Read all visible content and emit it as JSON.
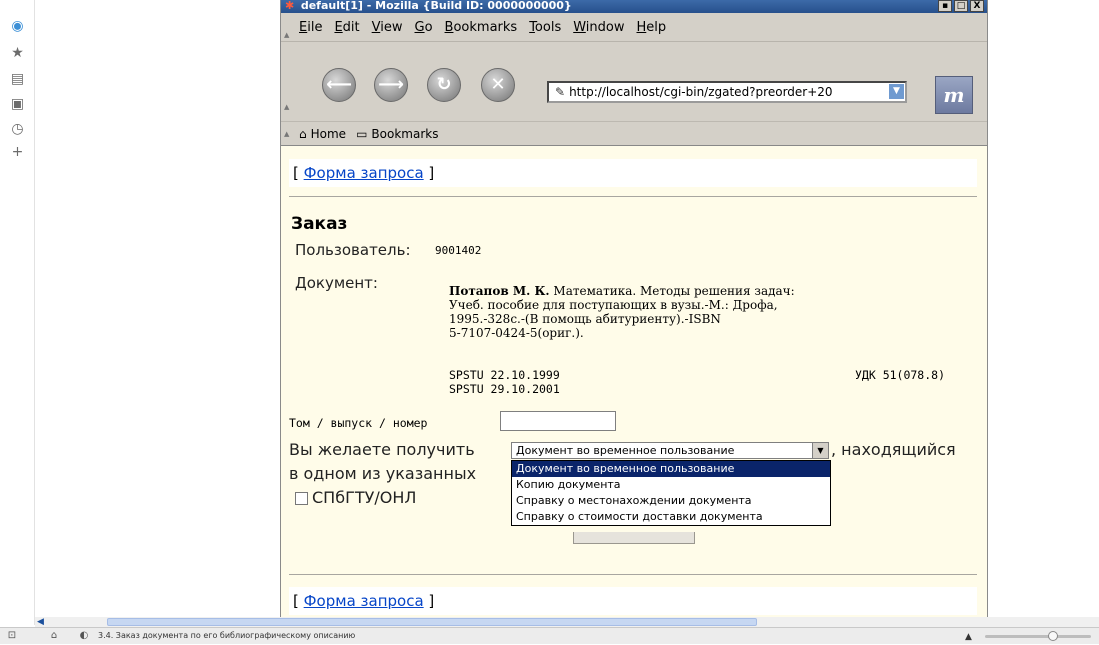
{
  "window": {
    "title": "default[1] - Mozilla {Build ID: 0000000000}",
    "buttons": [
      "▪",
      "□",
      "X"
    ]
  },
  "menu": {
    "items": [
      {
        "key": "E",
        "rest": "ile"
      },
      {
        "key": "E",
        "rest": "dit"
      },
      {
        "key": "V",
        "rest": "iew"
      },
      {
        "key": "G",
        "rest": "o"
      },
      {
        "key": "B",
        "rest": "ookmarks"
      },
      {
        "key": "T",
        "rest": "ools"
      },
      {
        "key": "W",
        "rest": "indow"
      },
      {
        "key": "H",
        "rest": "elp"
      }
    ]
  },
  "nav": {
    "url": "http://localhost/cgi-bin/zgated?preorder+20",
    "throbber": "m"
  },
  "personal_bar": {
    "home": "Home",
    "bookmarks": "Bookmarks"
  },
  "page": {
    "request_form_link": "Форма запроса",
    "bracket_open": "[",
    "bracket_close": "]",
    "title": "Заказ",
    "user_label": "Пользователь:",
    "user_value": "9001402",
    "doc_label": "Документ:",
    "doc_author": "Потапов М. К.",
    "doc_text_line1": " Математика. Методы решения задач:",
    "doc_text_lines": "Учеб. пособие для поступающих в вузы.-М.: Дрофа,\n1995.-328с.-(В помощь абитуриенту).-ISBN\n5-7107-0424-5(ориг.).",
    "holding1": "SPSTU 22.10.1999",
    "holding2": "SPSTU 29.10.2001",
    "udc": "УДК 51(078.8)",
    "volume_label": "Том / выпуск / номер",
    "want_label": "Вы желаете получить",
    "located_label": ", находящийся",
    "in_one_label": "в одном из указанных",
    "library_option": "СПбГТУ/ОНЛ",
    "request_type": {
      "selected": "Документ во временное пользование",
      "options": [
        "Документ во временное пользование",
        "Копию документа",
        "Справку о местонахождении документа",
        "Справку о стоимости доставки документа"
      ]
    }
  },
  "status": {
    "text": "3.4. Заказ документа по его библиографическому описанию",
    "zoom_level": 0.66
  },
  "colors": {
    "page_background": "#fffce9",
    "link": "#0645c8",
    "selected_option": "#0a246a",
    "titlebar": "#27508c"
  }
}
